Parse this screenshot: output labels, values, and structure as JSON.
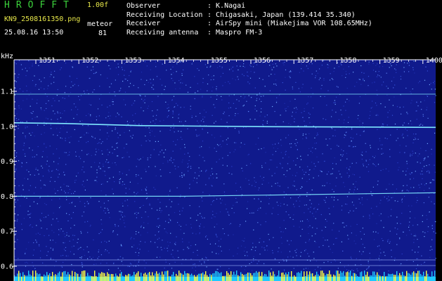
{
  "header": {
    "app_title": "HROFFT",
    "version": "1.00f",
    "filename": "KN9_2508161350.png",
    "datetime": "25.08.16 13:50",
    "meteor_label": "meteor",
    "meteor_count": "81"
  },
  "info": [
    {
      "key": "Observer",
      "value": ": K.Nagai"
    },
    {
      "key": "Receiving Location",
      "value": ": Chigasaki, Japan (139.414 35.340)"
    },
    {
      "key": "Receiver",
      "value": ": AirSpy mini (Miakejima VOR 108.65MHz)"
    },
    {
      "key": "Receiving antenna",
      "value": ": Maspro FM-3"
    }
  ],
  "spectrogram": {
    "y_unit": "kHz",
    "y_ticks": [
      "1.1",
      "1.0",
      "0.9",
      "0.8",
      "0.7",
      "0.6"
    ],
    "x_ticks": [
      "1351",
      "1352",
      "1353",
      "1354",
      "1355",
      "1356",
      "1357",
      "1358",
      "1359",
      "1400"
    ],
    "colors": {
      "background": "#101a8c",
      "signal": "#7fe8ff",
      "bottom_band": "#1ec8ff",
      "bottom_spikes": "#ffff40"
    }
  }
}
